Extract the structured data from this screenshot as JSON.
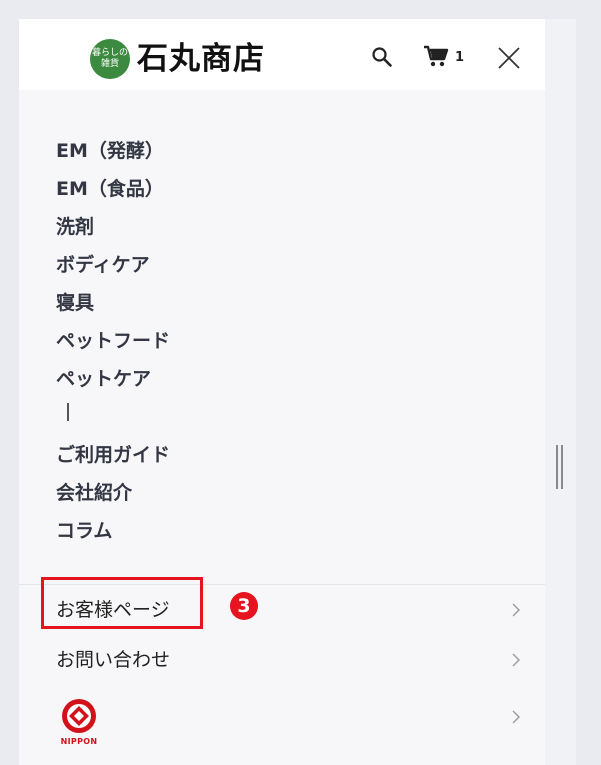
{
  "header": {
    "logo_badge_line1": "暮らしの",
    "logo_badge_line2": "雑貨",
    "logo_text": "石丸商店",
    "cart_count": "1",
    "icons": [
      "search-icon",
      "cart-icon",
      "close-icon"
    ]
  },
  "menu": {
    "items": [
      "EM（発酵）",
      "EM（食品）",
      "洗剤",
      "ボディケア",
      "寝具",
      "ペットフード",
      "ペットケア",
      "",
      "ご利用ガイド",
      "会社紹介",
      "コラム"
    ]
  },
  "links": {
    "account": "お客様ページ",
    "contact": "お問い合わせ",
    "nippon_logo_text": "NIPPON"
  },
  "annotation": {
    "step": "3",
    "color": "#e5141e"
  },
  "colors": {
    "logo_green": "#3c8a3f",
    "nippon_red": "#d2121a",
    "menu_text": "#333743"
  }
}
